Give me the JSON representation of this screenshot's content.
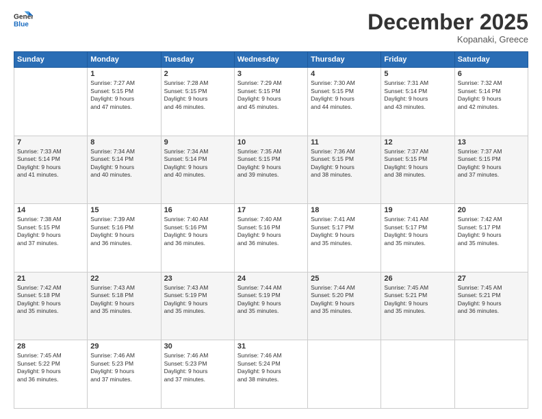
{
  "logo": {
    "line1": "General",
    "line2": "Blue"
  },
  "header": {
    "month": "December 2025",
    "location": "Kopanaki, Greece"
  },
  "weekdays": [
    "Sunday",
    "Monday",
    "Tuesday",
    "Wednesday",
    "Thursday",
    "Friday",
    "Saturday"
  ],
  "weeks": [
    [
      {
        "day": "",
        "info": ""
      },
      {
        "day": "1",
        "info": "Sunrise: 7:27 AM\nSunset: 5:15 PM\nDaylight: 9 hours\nand 47 minutes."
      },
      {
        "day": "2",
        "info": "Sunrise: 7:28 AM\nSunset: 5:15 PM\nDaylight: 9 hours\nand 46 minutes."
      },
      {
        "day": "3",
        "info": "Sunrise: 7:29 AM\nSunset: 5:15 PM\nDaylight: 9 hours\nand 45 minutes."
      },
      {
        "day": "4",
        "info": "Sunrise: 7:30 AM\nSunset: 5:15 PM\nDaylight: 9 hours\nand 44 minutes."
      },
      {
        "day": "5",
        "info": "Sunrise: 7:31 AM\nSunset: 5:14 PM\nDaylight: 9 hours\nand 43 minutes."
      },
      {
        "day": "6",
        "info": "Sunrise: 7:32 AM\nSunset: 5:14 PM\nDaylight: 9 hours\nand 42 minutes."
      }
    ],
    [
      {
        "day": "7",
        "info": "Sunrise: 7:33 AM\nSunset: 5:14 PM\nDaylight: 9 hours\nand 41 minutes."
      },
      {
        "day": "8",
        "info": "Sunrise: 7:34 AM\nSunset: 5:14 PM\nDaylight: 9 hours\nand 40 minutes."
      },
      {
        "day": "9",
        "info": "Sunrise: 7:34 AM\nSunset: 5:14 PM\nDaylight: 9 hours\nand 40 minutes."
      },
      {
        "day": "10",
        "info": "Sunrise: 7:35 AM\nSunset: 5:15 PM\nDaylight: 9 hours\nand 39 minutes."
      },
      {
        "day": "11",
        "info": "Sunrise: 7:36 AM\nSunset: 5:15 PM\nDaylight: 9 hours\nand 38 minutes."
      },
      {
        "day": "12",
        "info": "Sunrise: 7:37 AM\nSunset: 5:15 PM\nDaylight: 9 hours\nand 38 minutes."
      },
      {
        "day": "13",
        "info": "Sunrise: 7:37 AM\nSunset: 5:15 PM\nDaylight: 9 hours\nand 37 minutes."
      }
    ],
    [
      {
        "day": "14",
        "info": "Sunrise: 7:38 AM\nSunset: 5:15 PM\nDaylight: 9 hours\nand 37 minutes."
      },
      {
        "day": "15",
        "info": "Sunrise: 7:39 AM\nSunset: 5:16 PM\nDaylight: 9 hours\nand 36 minutes."
      },
      {
        "day": "16",
        "info": "Sunrise: 7:40 AM\nSunset: 5:16 PM\nDaylight: 9 hours\nand 36 minutes."
      },
      {
        "day": "17",
        "info": "Sunrise: 7:40 AM\nSunset: 5:16 PM\nDaylight: 9 hours\nand 36 minutes."
      },
      {
        "day": "18",
        "info": "Sunrise: 7:41 AM\nSunset: 5:17 PM\nDaylight: 9 hours\nand 35 minutes."
      },
      {
        "day": "19",
        "info": "Sunrise: 7:41 AM\nSunset: 5:17 PM\nDaylight: 9 hours\nand 35 minutes."
      },
      {
        "day": "20",
        "info": "Sunrise: 7:42 AM\nSunset: 5:17 PM\nDaylight: 9 hours\nand 35 minutes."
      }
    ],
    [
      {
        "day": "21",
        "info": "Sunrise: 7:42 AM\nSunset: 5:18 PM\nDaylight: 9 hours\nand 35 minutes."
      },
      {
        "day": "22",
        "info": "Sunrise: 7:43 AM\nSunset: 5:18 PM\nDaylight: 9 hours\nand 35 minutes."
      },
      {
        "day": "23",
        "info": "Sunrise: 7:43 AM\nSunset: 5:19 PM\nDaylight: 9 hours\nand 35 minutes."
      },
      {
        "day": "24",
        "info": "Sunrise: 7:44 AM\nSunset: 5:19 PM\nDaylight: 9 hours\nand 35 minutes."
      },
      {
        "day": "25",
        "info": "Sunrise: 7:44 AM\nSunset: 5:20 PM\nDaylight: 9 hours\nand 35 minutes."
      },
      {
        "day": "26",
        "info": "Sunrise: 7:45 AM\nSunset: 5:21 PM\nDaylight: 9 hours\nand 35 minutes."
      },
      {
        "day": "27",
        "info": "Sunrise: 7:45 AM\nSunset: 5:21 PM\nDaylight: 9 hours\nand 36 minutes."
      }
    ],
    [
      {
        "day": "28",
        "info": "Sunrise: 7:45 AM\nSunset: 5:22 PM\nDaylight: 9 hours\nand 36 minutes."
      },
      {
        "day": "29",
        "info": "Sunrise: 7:46 AM\nSunset: 5:23 PM\nDaylight: 9 hours\nand 37 minutes."
      },
      {
        "day": "30",
        "info": "Sunrise: 7:46 AM\nSunset: 5:23 PM\nDaylight: 9 hours\nand 37 minutes."
      },
      {
        "day": "31",
        "info": "Sunrise: 7:46 AM\nSunset: 5:24 PM\nDaylight: 9 hours\nand 38 minutes."
      },
      {
        "day": "",
        "info": ""
      },
      {
        "day": "",
        "info": ""
      },
      {
        "day": "",
        "info": ""
      }
    ]
  ]
}
